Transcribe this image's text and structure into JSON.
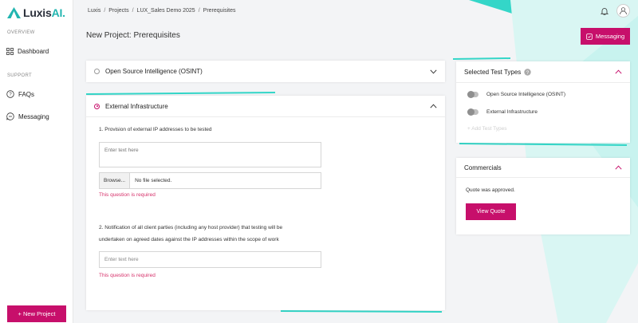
{
  "brand": {
    "name": "Luxis",
    "name_suffix": "AI.",
    "accent": "#c70f6b",
    "teal": "#22b5b0"
  },
  "sidebar": {
    "overview_label": "OVERVIEW",
    "support_label": "SUPPORT",
    "items": [
      {
        "label": "Dashboard",
        "icon": "grid-icon"
      },
      {
        "label": "FAQs",
        "icon": "help-icon"
      },
      {
        "label": "Messaging",
        "icon": "chat-icon"
      }
    ],
    "new_project_label": "+ New Project"
  },
  "header": {
    "breadcrumb": [
      "Luxis",
      "Projects",
      "LUX_Sales Demo 2025",
      "Prerequisites"
    ],
    "breadcrumb_sep": "/",
    "title": "New Project: Prerequisites",
    "messaging_button": "Messaging"
  },
  "main": {
    "osint_title": "Open Source Intelligence (OSINT)",
    "external_title": "External Infrastructure",
    "q1_label": "1. Provision of external IP addresses to be tested",
    "q1_placeholder": "Enter text here",
    "browse_label": "Browse...",
    "no_file_label": "No file selected.",
    "q1_error": "This question is required",
    "q2_label_line1": "2. Notification of all client parties (including any host provider) that testing will be",
    "q2_label_line2": "undertaken on agreed dates against the IP addresses within the scope of work",
    "q2_placeholder": "Enter text here",
    "q2_error": "This question is required"
  },
  "selected_tests": {
    "title": "Selected Test Types",
    "items": [
      "Open Source Intelligence (OSINT)",
      "External Infrastructure"
    ],
    "add_label": "+ Add Test Types"
  },
  "commercials": {
    "title": "Commercials",
    "status": "Quote was approved.",
    "view_quote_label": "View Quote"
  }
}
